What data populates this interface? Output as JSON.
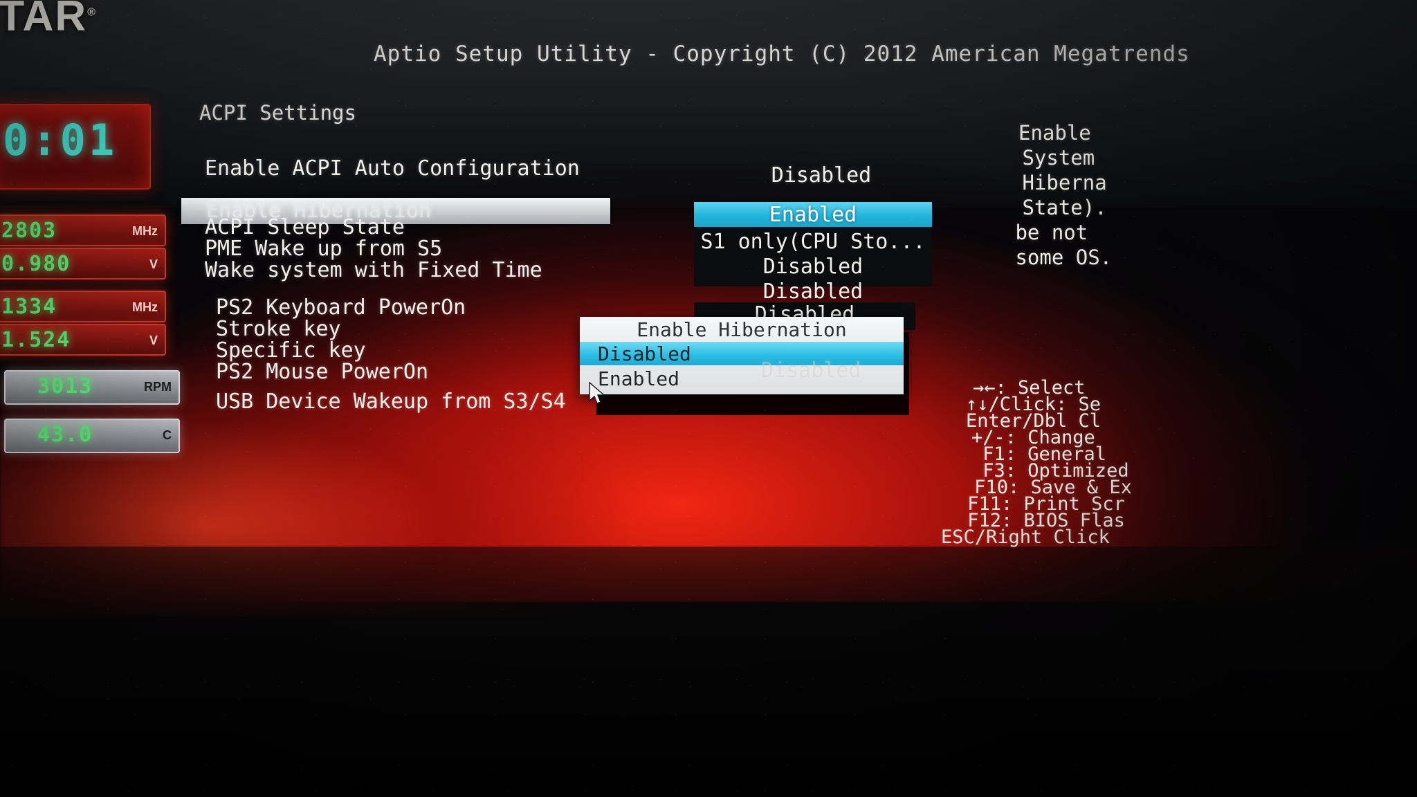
{
  "brand": {
    "logo_text": "STAR",
    "trademark": "®"
  },
  "hardware_monitor": {
    "clock": "0:01",
    "rows": [
      {
        "value": "2803",
        "unit": "MHz"
      },
      {
        "value": "0.980",
        "unit": "V"
      },
      {
        "value": "1334",
        "unit": "MHz"
      },
      {
        "value": "1.524",
        "unit": "V"
      },
      {
        "value": "3013",
        "unit": "RPM"
      },
      {
        "value": "43.0",
        "unit": "C"
      }
    ]
  },
  "bios": {
    "title": "Aptio Setup Utility - Copyright (C) 2012 American Megatrends",
    "section_header": "ACPI Settings",
    "items": [
      {
        "label": "Enable ACPI Auto Configuration",
        "value": "Disabled"
      },
      {
        "label": "Enable Hibernation",
        "value": "Enabled",
        "selected": true
      },
      {
        "label": "ACPI Sleep State",
        "value": "S1 only(CPU Sto..."
      },
      {
        "label": "PME Wake up from S5",
        "value": "Disabled"
      },
      {
        "label": "Wake system with Fixed Time",
        "value": "Disabled"
      },
      {
        "label": "PS2 Keyboard PowerOn",
        "value": "Disabled"
      },
      {
        "label": "Stroke key",
        "value": ""
      },
      {
        "label": "Specific key",
        "value": ""
      },
      {
        "label": "PS2 Mouse PowerOn",
        "value": ""
      },
      {
        "label": "USB Device Wakeup from S3/S4",
        "value": ""
      }
    ],
    "value_column": {
      "highlighted": "Enabled",
      "options": [
        "S1 only(CPU Sto...",
        "Disabled",
        "Disabled"
      ],
      "second_value": "Disabled",
      "ghost_value": "Disabled"
    },
    "popup": {
      "title": "Enable Hibernation",
      "options": [
        {
          "label": "Disabled",
          "selected": true
        },
        {
          "label": "Enabled",
          "selected": false
        }
      ]
    },
    "help_text_lines": [
      "Enable",
      " System",
      " Hiberna",
      " State).",
      " be not ",
      " some OS."
    ],
    "key_legend": [
      "→←: Select",
      "↑↓/Click: Se",
      "Enter/Dbl Cl",
      "+/-: Change",
      " F1: General ",
      " F3: Optimized",
      " F10: Save & Ex",
      " F11: Print Scr",
      " F12: BIOS Flas",
      "ESC/Right Click"
    ]
  },
  "colors": {
    "accent_blue": "#29bce3",
    "screen_text": "#f2f0ea",
    "panel_red": "#b8251d",
    "lcd_green": "#5bf07a",
    "lcd_cyan": "#47e8d8"
  }
}
